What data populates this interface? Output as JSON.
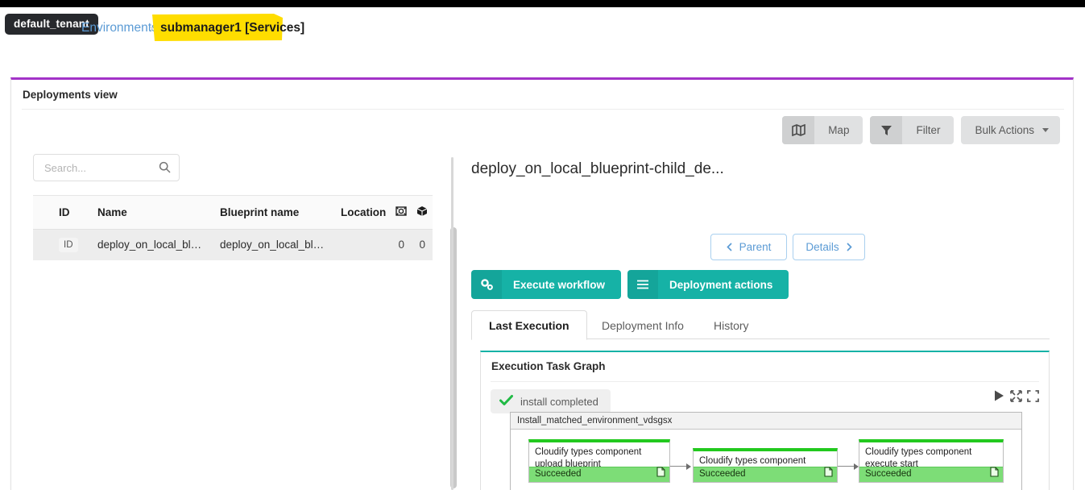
{
  "breadcrumb": {
    "tenant": "default_tenant",
    "environments": "Environments",
    "separator": "›",
    "current": "submanager1 [Services]",
    "highlight_color": "#ffdd00"
  },
  "card": {
    "title": "Deployments view",
    "accent_color": "#a333c8"
  },
  "toolbar": {
    "map_label": "Map",
    "filter_label": "Filter",
    "bulk_actions_label": "Bulk Actions"
  },
  "search": {
    "placeholder": "Search...",
    "value": ""
  },
  "table": {
    "columns": [
      "ID",
      "Name",
      "Blueprint name",
      "Location",
      "site-icon",
      "package-icon"
    ],
    "rows": [
      {
        "id": "ID",
        "name": "deploy_on_local_bluep...",
        "blueprint_name": "deploy_on_local_bluep...",
        "location": "",
        "site_count": "0",
        "package_count": "0"
      }
    ]
  },
  "details": {
    "deployment_title": "deploy_on_local_blueprint-child_de...",
    "parent_label": "Parent",
    "details_label": "Details",
    "execute_workflow_label": "Execute workflow",
    "deployment_actions_label": "Deployment actions",
    "accent_color": "#16b2a6"
  },
  "tabs": [
    {
      "label": "Last Execution",
      "active": true
    },
    {
      "label": "Deployment Info",
      "active": false
    },
    {
      "label": "History",
      "active": false
    }
  ],
  "graph": {
    "title": "Execution Task Graph",
    "status": "install completed",
    "group_label": "Install_matched_environment_vdsgsx",
    "node_success_color": "#22c91e",
    "node_footer_color": "#7ddd77",
    "nodes": [
      {
        "label": "Cloudify types component upload blueprint",
        "status": "Succeeded"
      },
      {
        "label": "Cloudify types component create",
        "status": "Succeeded"
      },
      {
        "label": "Cloudify types component execute start",
        "status": "Succeeded"
      }
    ],
    "controls": [
      "play-icon",
      "expand-icon",
      "fullscreen-icon"
    ]
  }
}
